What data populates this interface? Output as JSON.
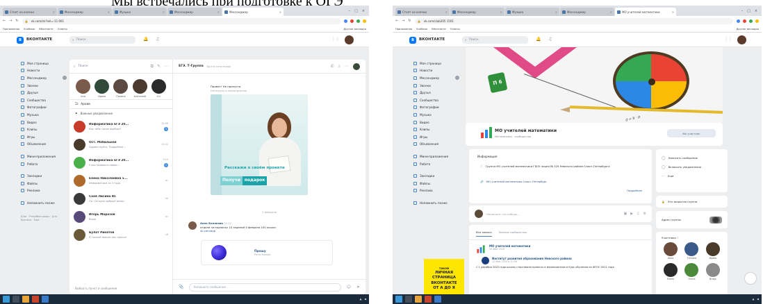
{
  "caption": "Мы встречались при подготовке к ОГЭ",
  "left": {
    "tabs": [
      "Стоят на колени",
      "Мессенджер",
      "Музыка",
      "Мессенджер",
      "Мессенджер"
    ],
    "url": "vk.com/im?sel=-11 001",
    "bookmarks": [
      "Приложения",
      "Учебные",
      "ВКонтакте",
      "Ответы",
      "Другие закладки"
    ],
    "vk_name": "ВКОНТАКТЕ",
    "search_placeholder": "Поиск",
    "nav": [
      "Моя страница",
      "Новости",
      "Мессенджер",
      "Звонки",
      "Друзья",
      "Сообщества",
      "Фотографии",
      "Музыка",
      "Видео",
      "Клипы",
      "Игры",
      "Объявления",
      "Мини-приложения",
      "Работа",
      "Закладки",
      "Файлы",
      "Реклама",
      "Напомнить позже"
    ],
    "nav_footer": "Блог · Разработчикам · Для бизнеса · Ещё",
    "chat_search": "Поиск",
    "stories": [
      {
        "name": "Аня",
        "color": "#7a5a4a"
      },
      {
        "name": "Ирина",
        "color": "#324a3a"
      },
      {
        "name": "Полина",
        "color": "#5c4a42"
      },
      {
        "name": "Анатолий",
        "color": "#4a3a30"
      },
      {
        "name": "Ел",
        "color": "#2a2a2a"
      }
    ],
    "sections": [
      "Архив",
      "Важные уведомления"
    ],
    "chats": [
      {
        "name": "Информатика ЕГЭ 20...",
        "preview": "Как тебе такое вообще?",
        "time": "11:08",
        "unread": "5",
        "color": "#c83a2a"
      },
      {
        "name": "Ост. Мобильная",
        "preview": "Здравствуйте, Подробнее...",
        "time": "10:42",
        "unread": "",
        "color": "#4a3a2a"
      },
      {
        "name": "Информатика ЕГЭ 20...",
        "preview": "У вас появился новое...",
        "time": "9:10",
        "unread": "2",
        "color": "#4ab04a"
      },
      {
        "name": "Елена Николаевна з...",
        "preview": "Информатика за 3 года",
        "time": "вт",
        "unread": "",
        "color": "#ad6a2a"
      },
      {
        "name": "Соня Лисина Ю.",
        "preview": "Ок. Сегодня добрый вечер",
        "time": "пн",
        "unread": "",
        "color": "#3a3a3a"
      },
      {
        "name": "Игорь Морозов",
        "preview": "Ваше",
        "time": "вс",
        "unread": "",
        "color": "#5a4a7a"
      },
      {
        "name": "Булат Ринатов",
        "preview": "Я точный вопрос вас просил",
        "time": "сб",
        "unread": "",
        "color": "#6a5a3a"
      }
    ],
    "chat_footer": "Выбрать пункт и сообщения",
    "chat_title": "ЕГЭ. Т-Группа",
    "chat_sub": "Был в сети вчера",
    "top_message_1": "Привет! Не пропусти",
    "top_message_2": "Конкурсы и мероприятия",
    "promo_text": "Расскажи о своём проекте",
    "promo_btn_1": "Получи",
    "promo_btn_2": "подарок",
    "date_separator": "1 февраля",
    "msg_name": "Анна Белякова",
    "msg_time": "14:12",
    "msg_text": "отдали за подписку 15 заданий 4 февраля 100 кошки",
    "msg_link": "vk.com/app",
    "attach_title": "Прошу",
    "attach_sub": "Регистрация",
    "composer_placeholder": "Напишите сообщение..."
  },
  "right": {
    "tabs": [
      "Стоят на колени",
      "Мессенджер",
      "Музыка",
      "Мессенджер",
      "МО учителей математики"
    ],
    "url": "vk.com/club205 1501",
    "vk_name": "ВКОНТАКТЕ",
    "search_placeholder": "Поиск",
    "nav": [
      "Моя страница",
      "Новости",
      "Мессенджер",
      "Звонки",
      "Друзья",
      "Сообщества",
      "Фотографии",
      "Музыка",
      "Видео",
      "Клипы",
      "Игры",
      "Объявления",
      "Мини-приложения",
      "Работа",
      "Закладки",
      "Файлы",
      "Реклама",
      "Напомнить позже"
    ],
    "cube_label": "П 6",
    "formula": "d = b · p",
    "group_name": "МО учителей математики",
    "group_sub": "Математика · сообщество",
    "group_btn": "Вы участник",
    "info_title": "Информация",
    "info_1": "Группа МО учителей математики ГБОУ лицея № 329 Невского района Санкт-Петербурга",
    "info_2": "МО учителей математики Санкт-Петербург",
    "info_sub": "Подробнее",
    "post_placeholder": "Напишите что-нибудь...",
    "feed_tabs": [
      "Все записи",
      "Записи сообщества"
    ],
    "feed_name": "МО учителей математики",
    "feed_date": "19 фев 2024",
    "repost_name": "Институт развития образования Невского района",
    "repost_date": "12 фев 2024 в 12:58",
    "feed_text": "С 1 декабря 2022 года школы стартовали проекты в мероприятиях в Курс обучения по ФГОС 2021 года",
    "yellow_1": "ТАКОЙ",
    "yellow_2": "ЛИЧНАЯ",
    "yellow_3": "СТРАНИЦА",
    "yellow_4": "ВКОНТАКТЕ",
    "yellow_5": "ОТ А ДО Я",
    "side_menu": [
      "Написать сообщение",
      "Включить уведомления",
      "Ещё"
    ],
    "side_more": "Это закрытая группа",
    "side_addr": "Адрес группы",
    "members_title": "Участники",
    "members_count": "7",
    "members": [
      {
        "name": "Анна",
        "color": "#6a4a3a"
      },
      {
        "name": "Татьяна",
        "color": "#3a5a8a"
      },
      {
        "name": "Ирина",
        "color": "#4a3a2a"
      },
      {
        "name": "Елена",
        "color": "#2a2a2a"
      },
      {
        "name": "Ольга",
        "color": "#4a8a3a"
      },
      {
        "name": "Игорь",
        "color": "#8a8a8a"
      }
    ]
  }
}
